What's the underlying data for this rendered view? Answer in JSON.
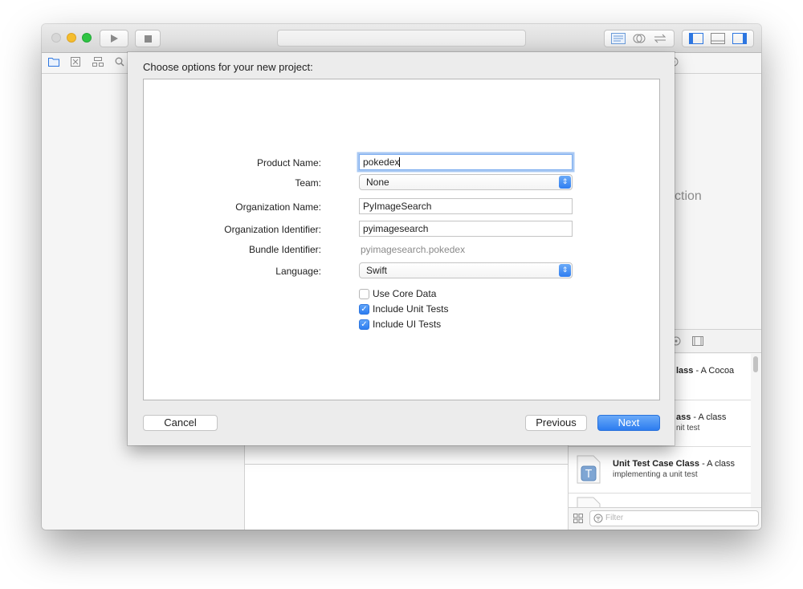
{
  "colors": {
    "close": "#d7d7d7",
    "minimize": "#f5bd2d",
    "zoom": "#2fc443",
    "accent": "#2c7cf0"
  },
  "toolbar": {
    "run_icon": "play-icon",
    "stop_icon": "stop-icon",
    "editor_icons": [
      "standard-editor-icon",
      "assistant-editor-icon",
      "version-editor-icon"
    ],
    "view_icons": [
      "navigator-toggle-icon",
      "debug-area-toggle-icon",
      "utilities-toggle-icon"
    ]
  },
  "navigator_icons": [
    "folder-icon",
    "source-control-icon",
    "symbol-icon",
    "find-icon"
  ],
  "center": {
    "ghost_text": "ction"
  },
  "library": {
    "header_icons": [
      "object-library-icon",
      "media-library-icon"
    ],
    "items": [
      {
        "title": "lass",
        "title_suffix": " - A Cocoa",
        "desc": ""
      },
      {
        "title": "ass",
        "title_suffix": " - A class",
        "desc": "nit test"
      },
      {
        "title": "Unit Test Case Class",
        "title_suffix": " - A class",
        "desc": "implementing a unit test",
        "icon_letter": "T"
      }
    ],
    "filter_placeholder": "Filter"
  },
  "sheet": {
    "title": "Choose options for your new project:",
    "fields": {
      "product_name_label": "Product Name:",
      "product_name_value": "pokedex",
      "team_label": "Team:",
      "team_value": "None",
      "org_name_label": "Organization Name:",
      "org_name_value": "PyImageSearch",
      "org_id_label": "Organization Identifier:",
      "org_id_value": "pyimagesearch",
      "bundle_id_label": "Bundle Identifier:",
      "bundle_id_value": "pyimagesearch.pokedex",
      "language_label": "Language:",
      "language_value": "Swift"
    },
    "options": [
      {
        "label": "Use Core Data",
        "checked": false
      },
      {
        "label": "Include Unit Tests",
        "checked": true
      },
      {
        "label": "Include UI Tests",
        "checked": true
      }
    ],
    "buttons": {
      "cancel": "Cancel",
      "previous": "Previous",
      "next": "Next"
    }
  }
}
